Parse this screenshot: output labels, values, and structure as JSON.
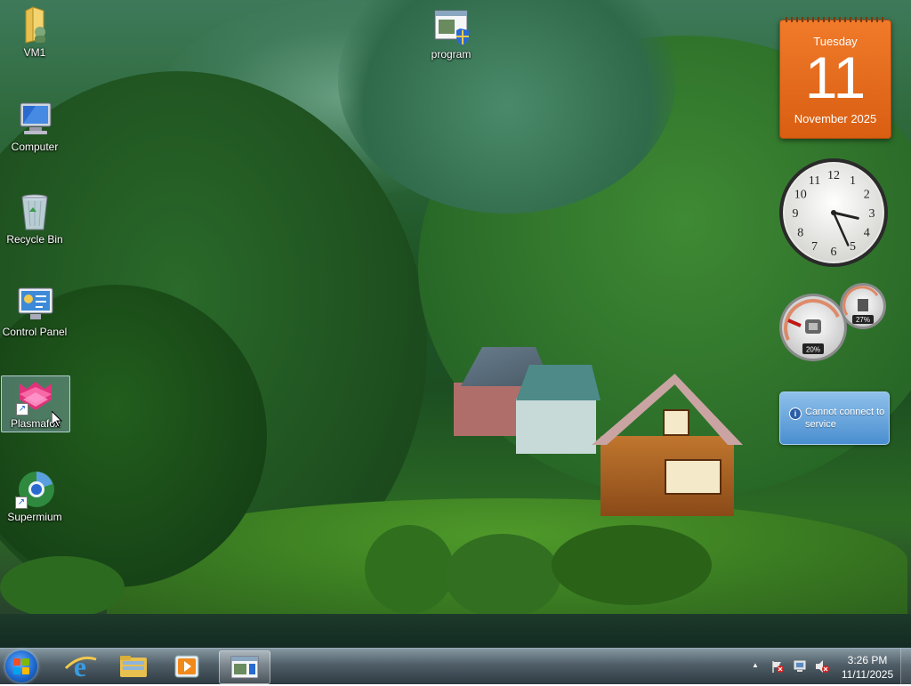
{
  "desktop": {
    "icons": [
      {
        "label": "VM1"
      },
      {
        "label": "Computer"
      },
      {
        "label": "Recycle Bin"
      },
      {
        "label": "Control Panel"
      },
      {
        "label": "Plasmafox"
      },
      {
        "label": "Supermium"
      },
      {
        "label": "program"
      }
    ]
  },
  "gadgets": {
    "calendar": {
      "weekday": "Tuesday",
      "day": "11",
      "month_year": "November 2025"
    },
    "clock": {
      "numbers": [
        "12",
        "1",
        "2",
        "3",
        "4",
        "5",
        "6",
        "7",
        "8",
        "9",
        "10",
        "11"
      ],
      "hour": 3,
      "minute": 26
    },
    "meter": {
      "cpu": "20%",
      "memory": "27%"
    },
    "weather": {
      "message": "Cannot connect to service"
    }
  },
  "taskbar": {
    "time": "3:26 PM",
    "date": "11/11/2025",
    "tray_arrow": "▲"
  },
  "colors": {
    "calendar_orange": "#e8691c",
    "taskbar_dark": "#2c3a44",
    "weather_blue": "#5b9cd8"
  }
}
